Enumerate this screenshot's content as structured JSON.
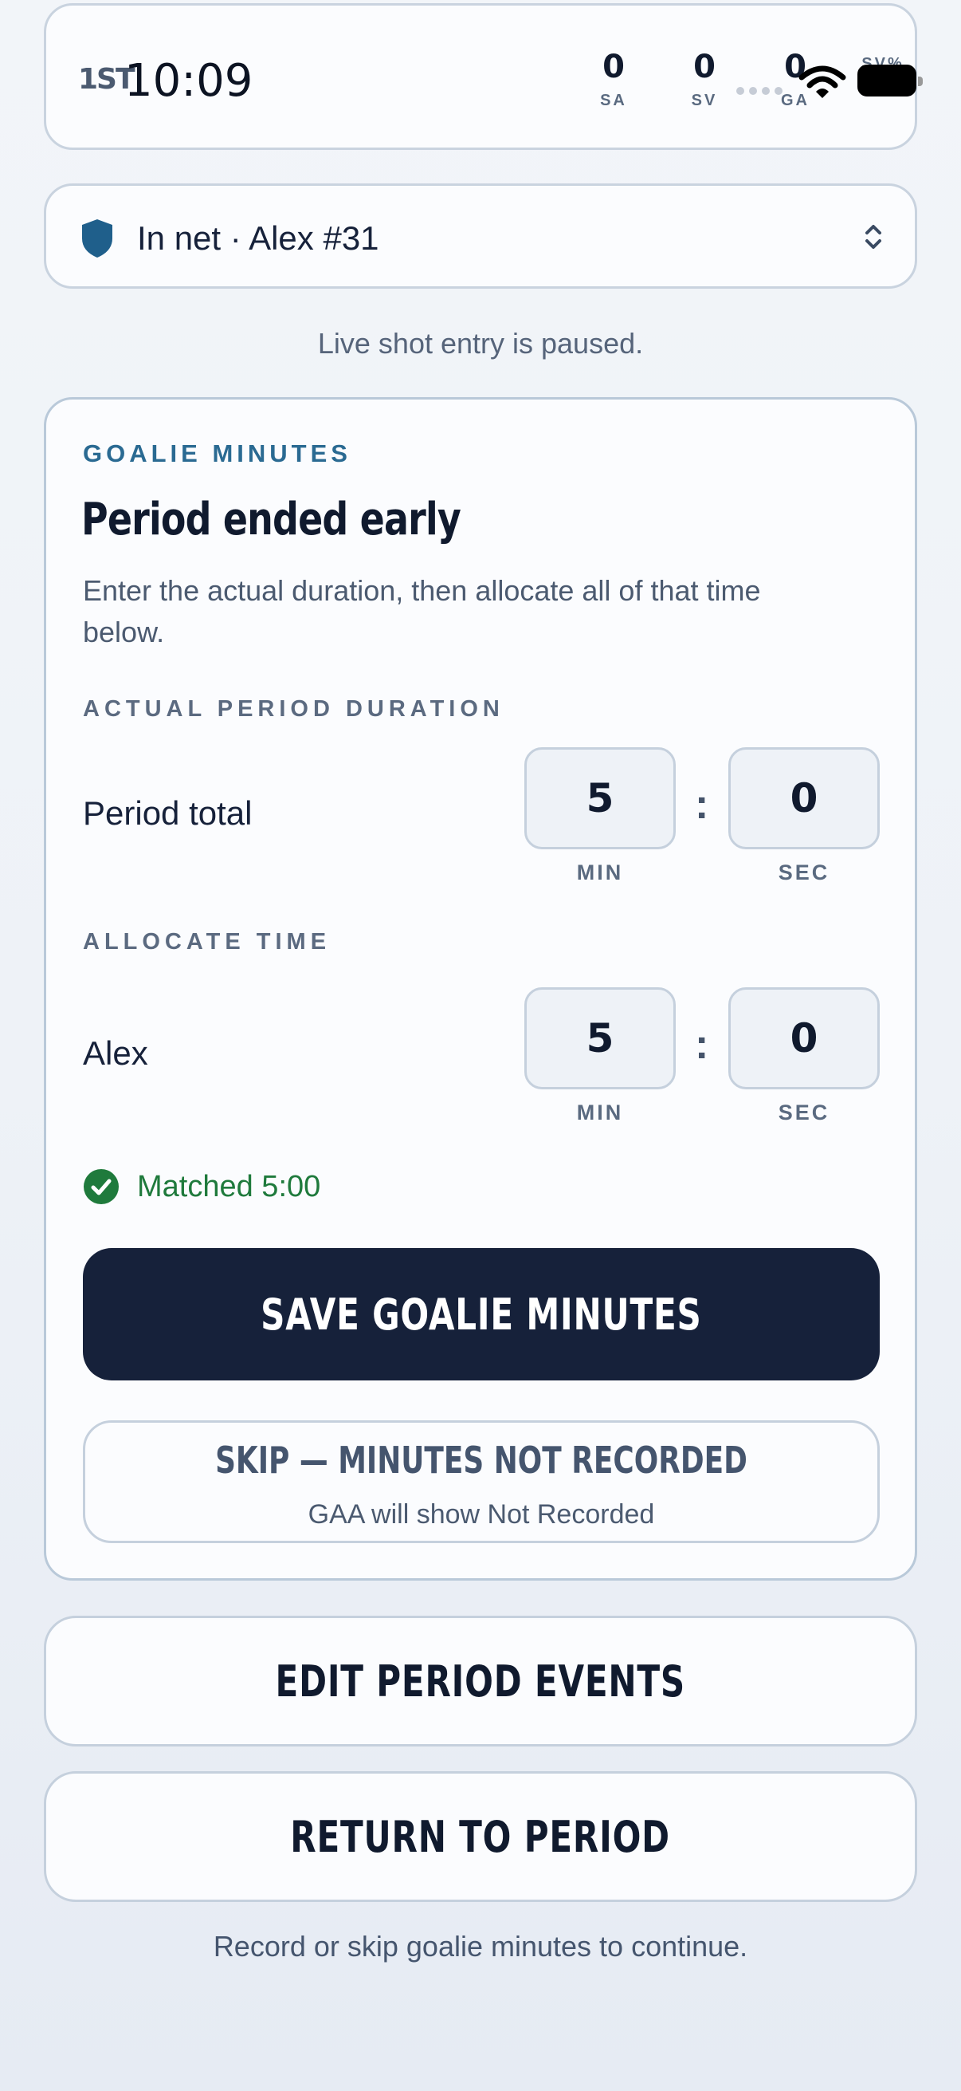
{
  "scoreboard": {
    "period": "1ST",
    "clock": "10:09",
    "stats": [
      {
        "value": "0",
        "label": "SA"
      },
      {
        "value": "0",
        "label": "SV"
      },
      {
        "value": "0",
        "label": "GA"
      },
      {
        "value": "",
        "label": "SV%"
      }
    ]
  },
  "goalie_select": {
    "label": "In net · Alex #31",
    "icon": "shield-icon",
    "accent": "#1f5f8b"
  },
  "paused_note": "Live shot entry is paused.",
  "goalie_minutes": {
    "eyebrow": "GOALIE MINUTES",
    "title": "Period ended early",
    "description": "Enter the actual duration, then allocate all of that time below.",
    "duration_section": "ACTUAL PERIOD DURATION",
    "period_total": {
      "label": "Period total",
      "min": "5",
      "sec": "0",
      "min_label": "MIN",
      "sec_label": "SEC"
    },
    "allocate_section": "ALLOCATE TIME",
    "allocation": {
      "label": "Alex",
      "min": "5",
      "sec": "0",
      "min_label": "MIN",
      "sec_label": "SEC"
    },
    "matched_text": "Matched 5:00",
    "matched_color": "#1f7a3c",
    "save_label": "SAVE GOALIE MINUTES",
    "skip_title": "SKIP — MINUTES NOT RECORDED",
    "skip_subtitle": "GAA will show Not Recorded"
  },
  "edit_button": "EDIT PERIOD EVENTS",
  "return_button": "RETURN TO PERIOD",
  "footer_note": "Record or skip goalie minutes to continue."
}
